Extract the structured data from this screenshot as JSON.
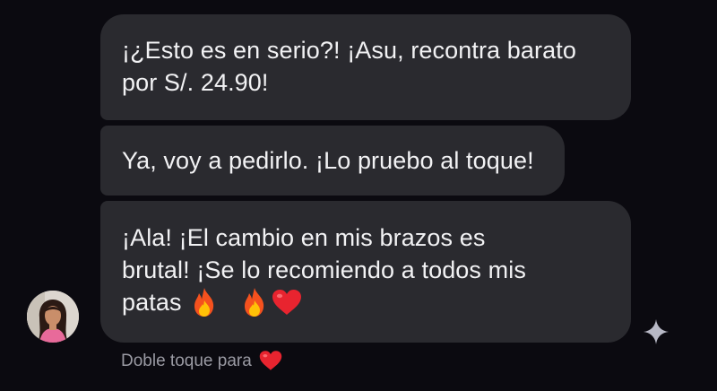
{
  "messages": [
    {
      "lines": [
        "¡¿Esto es en serio?! ¡Asu, recontra barato",
        "por S/. 24.90!"
      ]
    },
    {
      "lines": [
        "Ya, voy a pedirlo. ¡Lo pruebo al toque!"
      ]
    },
    {
      "lines": [
        "¡Ala! ¡El cambio en mis brazos es",
        "brutal! ¡Se lo recomiendo a todos mis",
        "patas"
      ],
      "emojis": [
        "fire-icon",
        "fire-icon",
        "heart-icon"
      ]
    }
  ],
  "hint": {
    "text": "Doble toque para",
    "icon": "heart-icon"
  },
  "colors": {
    "background": "#0b0a10",
    "bubble": "#2a2a2f",
    "text": "#f2f2f4",
    "hint": "#9a9aa3",
    "heart": "#e8242f",
    "fire_outer": "#f4511e",
    "fire_inner": "#ffc107"
  }
}
